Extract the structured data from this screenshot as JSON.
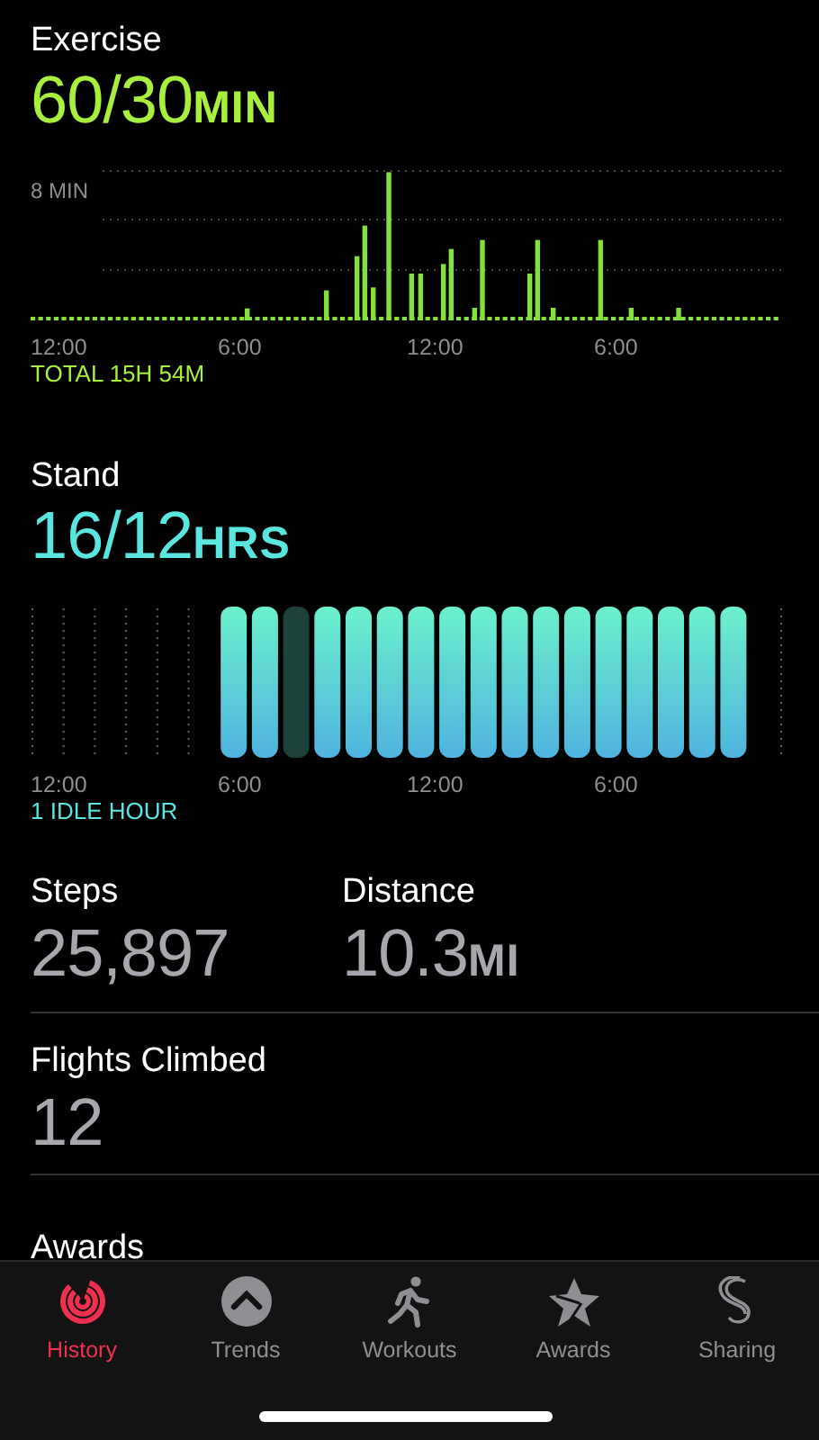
{
  "exercise": {
    "title": "Exercise",
    "value": "60/30",
    "unit": "MIN",
    "y_label": "8 MIN",
    "axis_labels": [
      "12:00",
      "6:00",
      "12:00",
      "6:00"
    ],
    "total": "TOTAL 15H 54M"
  },
  "stand": {
    "title": "Stand",
    "value": "16/12",
    "unit": "HRS",
    "axis_labels": [
      "12:00",
      "6:00",
      "12:00",
      "6:00"
    ],
    "idle": "1 IDLE HOUR",
    "hours": [
      {
        "kind": "empty"
      },
      {
        "kind": "empty"
      },
      {
        "kind": "empty"
      },
      {
        "kind": "empty"
      },
      {
        "kind": "empty"
      },
      {
        "kind": "empty"
      },
      {
        "kind": "stood"
      },
      {
        "kind": "stood"
      },
      {
        "kind": "idle"
      },
      {
        "kind": "stood"
      },
      {
        "kind": "stood"
      },
      {
        "kind": "stood"
      },
      {
        "kind": "stood"
      },
      {
        "kind": "stood"
      },
      {
        "kind": "stood"
      },
      {
        "kind": "stood"
      },
      {
        "kind": "stood"
      },
      {
        "kind": "stood"
      },
      {
        "kind": "stood"
      },
      {
        "kind": "stood"
      },
      {
        "kind": "stood"
      },
      {
        "kind": "stood"
      },
      {
        "kind": "stood"
      },
      {
        "kind": "empty"
      }
    ]
  },
  "stats": [
    {
      "label": "Steps",
      "value": "25,897"
    },
    {
      "label": "Distance",
      "value": "10.3",
      "unit": "MI"
    }
  ],
  "flights": {
    "label": "Flights Climbed",
    "value": "12"
  },
  "awards": {
    "label": "Awards"
  },
  "tabs": [
    {
      "label": "History",
      "selected": true,
      "kind": "history"
    },
    {
      "label": "Trends",
      "selected": false,
      "kind": "trends"
    },
    {
      "label": "Workouts",
      "selected": false,
      "kind": "workouts"
    },
    {
      "label": "Awards",
      "selected": false,
      "kind": "awards"
    },
    {
      "label": "Sharing",
      "selected": false,
      "kind": "sharing"
    }
  ]
}
